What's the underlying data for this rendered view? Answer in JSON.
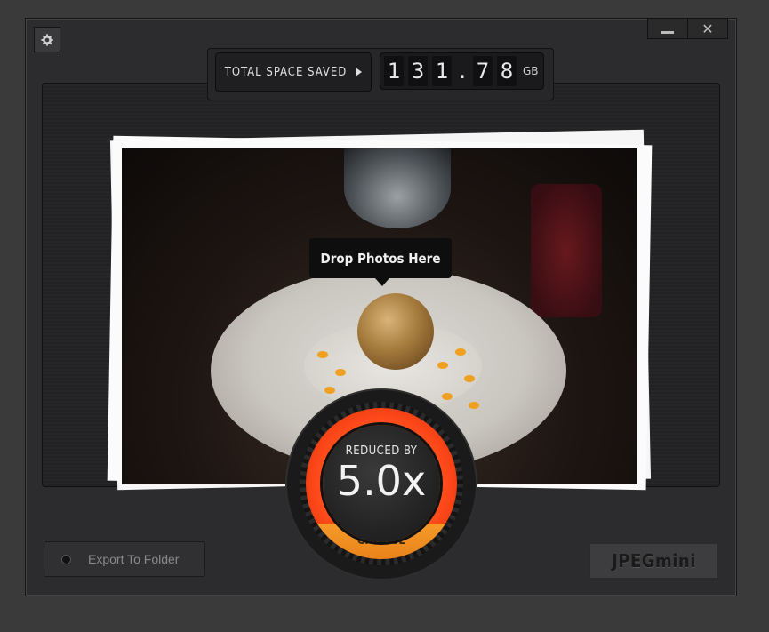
{
  "window": {
    "minimize_label": "",
    "close_label": "✕",
    "settings_icon": "gear-icon"
  },
  "header": {
    "total_space_label": "TOTAL SPACE SAVED",
    "counter_digits": [
      "1",
      "3",
      "1",
      ".",
      "7",
      "8"
    ],
    "counter_unit": "GB"
  },
  "drop_zone": {
    "tooltip": "Drop Photos Here"
  },
  "gauge": {
    "reduced_label": "REDUCED BY",
    "reduced_value": "5.0x",
    "choose_label": "CHOOSE",
    "accent": "#ff5a1f",
    "choose_color": "#f0921f"
  },
  "footer": {
    "export_label": "Export To Folder",
    "logo_text": "JPEGmini"
  }
}
